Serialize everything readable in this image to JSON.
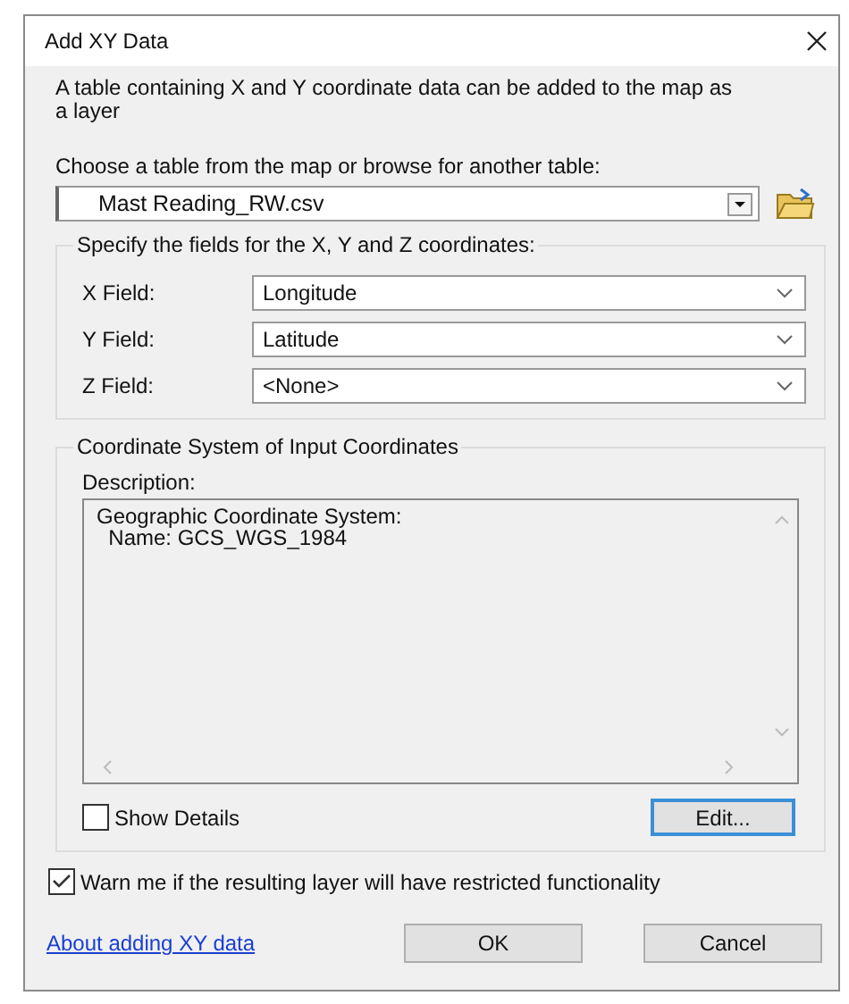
{
  "window": {
    "title": "Add XY Data"
  },
  "intro": "A table containing X and Y coordinate data can be added to the map as a layer",
  "table_prompt": "Choose a table from the map or browse for another table:",
  "table_combo": {
    "value": "Mast Reading_RW.csv"
  },
  "fields_group": {
    "title": "Specify the fields for the X, Y and Z coordinates:",
    "fields": [
      {
        "label": "X Field:",
        "value": "Longitude"
      },
      {
        "label": "Y Field:",
        "value": "Latitude"
      },
      {
        "label": "Z Field:",
        "value": "<None>"
      }
    ]
  },
  "coordinate_group": {
    "title": "Coordinate System of Input Coordinates",
    "description_label": "Description:",
    "description": "Geographic Coordinate System:\n  Name: GCS_WGS_1984",
    "show_details": {
      "label": "Show Details",
      "checked": false
    },
    "edit_button": {
      "label": "Edit...",
      "focused": true
    }
  },
  "warn": {
    "label": "Warn me if the resulting layer will have restricted functionality",
    "checked": true
  },
  "help_link": "About adding XY data",
  "buttons": [
    {
      "label": "OK"
    },
    {
      "label": "Cancel"
    }
  ]
}
